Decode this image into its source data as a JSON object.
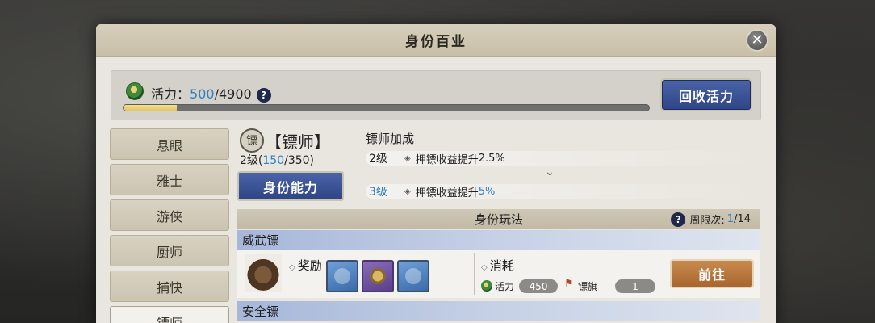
{
  "window": {
    "title": "身份百业",
    "close_icon": "close-icon"
  },
  "vitality": {
    "label": "活力：",
    "current": "500",
    "separator": "/",
    "max": "4900",
    "help": "?",
    "progress_fraction": 0.102,
    "button_label": "回收活力"
  },
  "sidebar": {
    "items": [
      {
        "label": "悬眼",
        "active": false
      },
      {
        "label": "雅士",
        "active": false
      },
      {
        "label": "游侠",
        "active": false
      },
      {
        "label": "厨师",
        "active": false
      },
      {
        "label": "捕快",
        "active": false
      },
      {
        "label": "镖师",
        "active": true
      }
    ]
  },
  "identity": {
    "name": "【镖师】",
    "level_prefix": "2级(",
    "level_cur": "150",
    "level_sep": "/350)",
    "ability_button": "身份能力"
  },
  "bonus": {
    "title": "镖师加成",
    "rows": [
      {
        "level": "2级",
        "text": "押镖收益提升",
        "pct": "2.5%"
      },
      {
        "level": "3级",
        "text": "押镖收益提升",
        "pct": "5%"
      }
    ],
    "chevron": "⌄"
  },
  "gameplay": {
    "title": "身份玩法",
    "limit_label": "周限次:",
    "limit_cur": "1",
    "limit_sep": "/14",
    "categories": [
      {
        "label": "威武镖"
      },
      {
        "label": "安全镖"
      }
    ],
    "mission": {
      "reward_label": "奖励",
      "cost_label": "消耗",
      "cost_vitality_name": "活力",
      "cost_vitality_value": "450",
      "cost_flag_name": "镖旗",
      "cost_flag_value": "1",
      "go_button": "前往"
    }
  },
  "colors": {
    "accent_blue": "#2f7fc1",
    "button_blue": "#2e4585",
    "button_orange": "#a86630"
  }
}
